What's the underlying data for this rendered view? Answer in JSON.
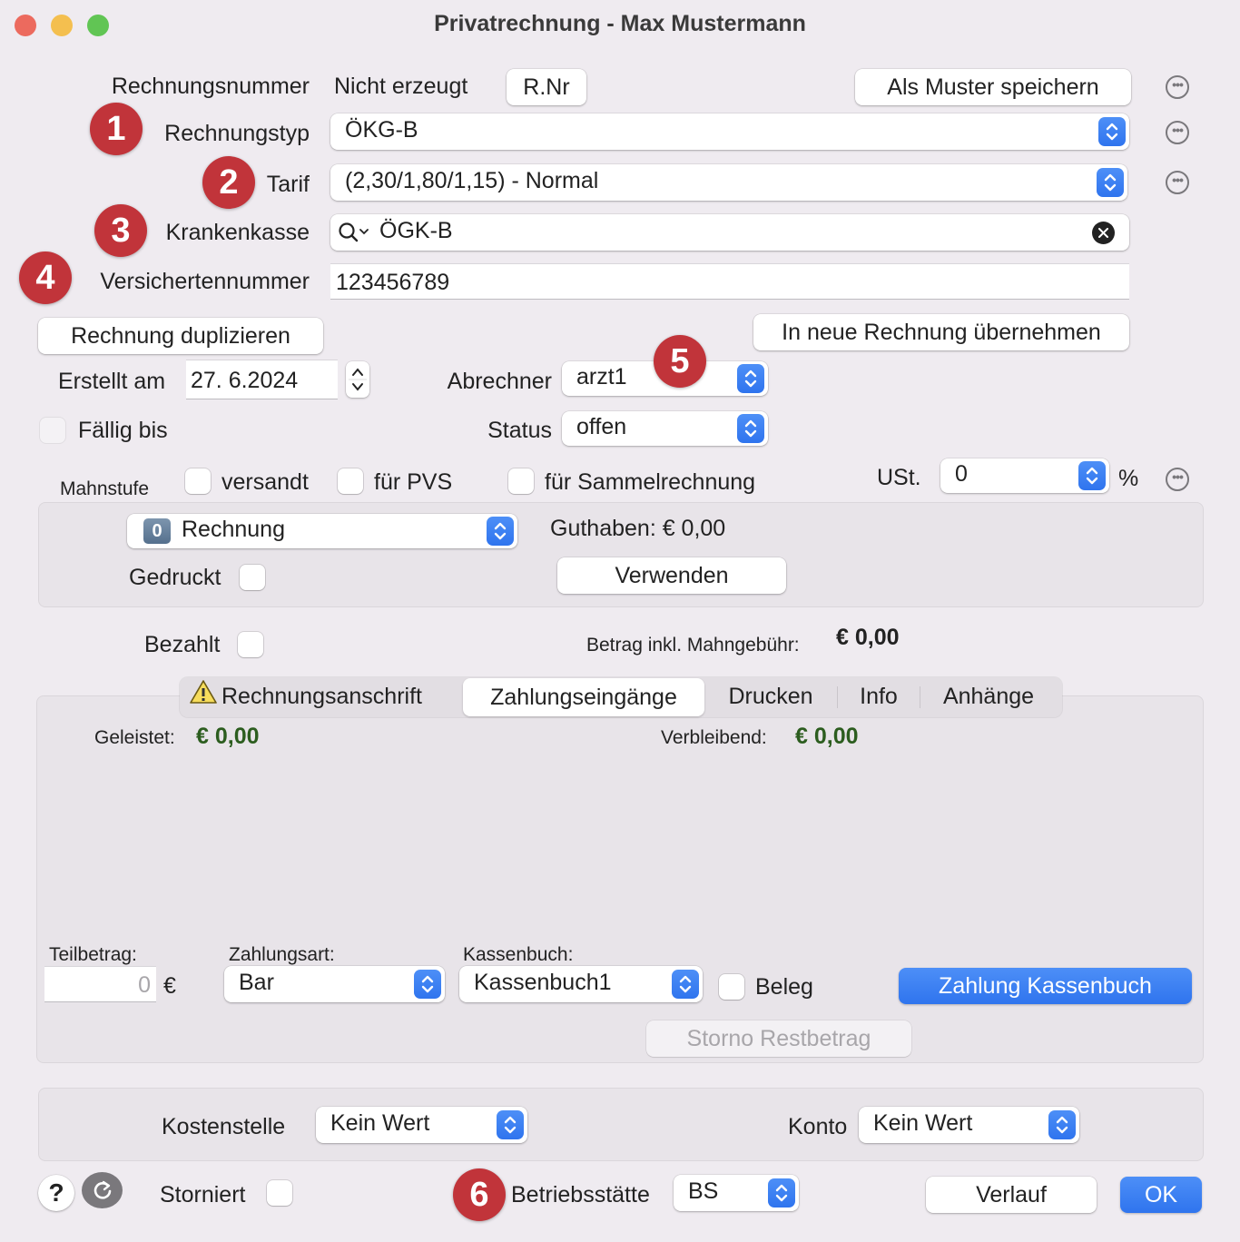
{
  "window": {
    "title": "Privatrechnung - Max Mustermann",
    "traffic_lights": {
      "close": "#ec6a5e",
      "minimize": "#f4bf4f",
      "zoom": "#61c554"
    }
  },
  "header": {
    "rechnungsnummer_label": "Rechnungsnummer",
    "rechnungsnummer_value": "Nicht erzeugt",
    "rnr_button": "R.Nr",
    "save_template_button": "Als Muster speichern",
    "rechnungstyp_label": "Rechnungstyp",
    "rechnungstyp_value": "ÖKG-B",
    "tarif_label": "Tarif",
    "tarif_value": "(2,30/1,80/1,15) - Normal",
    "krankenkasse_label": "Krankenkasse",
    "krankenkasse_value": "ÖGK-B",
    "versichertennummer_label": "Versichertennummer",
    "versichertennummer_value": "123456789"
  },
  "badges": [
    "1",
    "2",
    "3",
    "4",
    "5",
    "6"
  ],
  "actions": {
    "duplicate_button": "Rechnung duplizieren",
    "transfer_button": "In neue Rechnung übernehmen"
  },
  "details": {
    "erstellt_label": "Erstellt am",
    "erstellt_value": "27.  6.2024",
    "abrechner_label": "Abrechner",
    "abrechner_value": "arzt1",
    "faellig_label": "Fällig bis",
    "status_label": "Status",
    "status_value": "offen",
    "mahnstufe_label": "Mahnstufe",
    "versandt_label": "versandt",
    "pvs_label": "für PVS",
    "sammel_label": "für Sammelrechnung",
    "ust_label": "USt.",
    "ust_value": "0",
    "ust_unit": "%"
  },
  "mahn_group": {
    "mahnstufe_badge": "0",
    "mahnstufe_value": "Rechnung",
    "guthaben_label": "Guthaben: € 0,00",
    "gedruckt_label": "Gedruckt",
    "verwenden_button": "Verwenden"
  },
  "payment": {
    "bezahlt_label": "Bezahlt",
    "betrag_label": "Betrag inkl. Mahngebühr:",
    "betrag_value": "€ 0,00"
  },
  "tabs": [
    {
      "label": "Rechnungsanschrift",
      "icon": "warning-icon",
      "active": false
    },
    {
      "label": "Zahlungseingänge",
      "active": true
    },
    {
      "label": "Drucken",
      "active": false
    },
    {
      "label": "Info",
      "active": false
    },
    {
      "label": "Anhänge",
      "active": false
    }
  ],
  "zahlungseingaenge": {
    "geleistet_label": "Geleistet:",
    "geleistet_value": "€ 0,00",
    "verbleibend_label": "Verbleibend:",
    "verbleibend_value": "€ 0,00",
    "teilbetrag_label": "Teilbetrag:",
    "teilbetrag_value": "0",
    "currency": "€",
    "zahlungsart_label": "Zahlungsart:",
    "zahlungsart_value": "Bar",
    "kassenbuch_label": "Kassenbuch:",
    "kassenbuch_value": "Kassenbuch1",
    "beleg_label": "Beleg",
    "zahlung_button": "Zahlung Kassenbuch",
    "storno_button": "Storno Restbetrag"
  },
  "accounting": {
    "kostenstelle_label": "Kostenstelle",
    "kostenstelle_value": "Kein Wert",
    "konto_label": "Konto",
    "konto_value": "Kein Wert"
  },
  "footer": {
    "help_button": "?",
    "storniert_label": "Storniert",
    "betriebsstaette_label": "Betriebsstätte",
    "betriebsstaette_value": "BS",
    "verlauf_button": "Verlauf",
    "ok_button": "OK"
  },
  "colors": {
    "accent": "#3b82f6",
    "badge": "#c1343a",
    "amount_green": "#2c5d1f",
    "window_bg": "#efebf0"
  }
}
